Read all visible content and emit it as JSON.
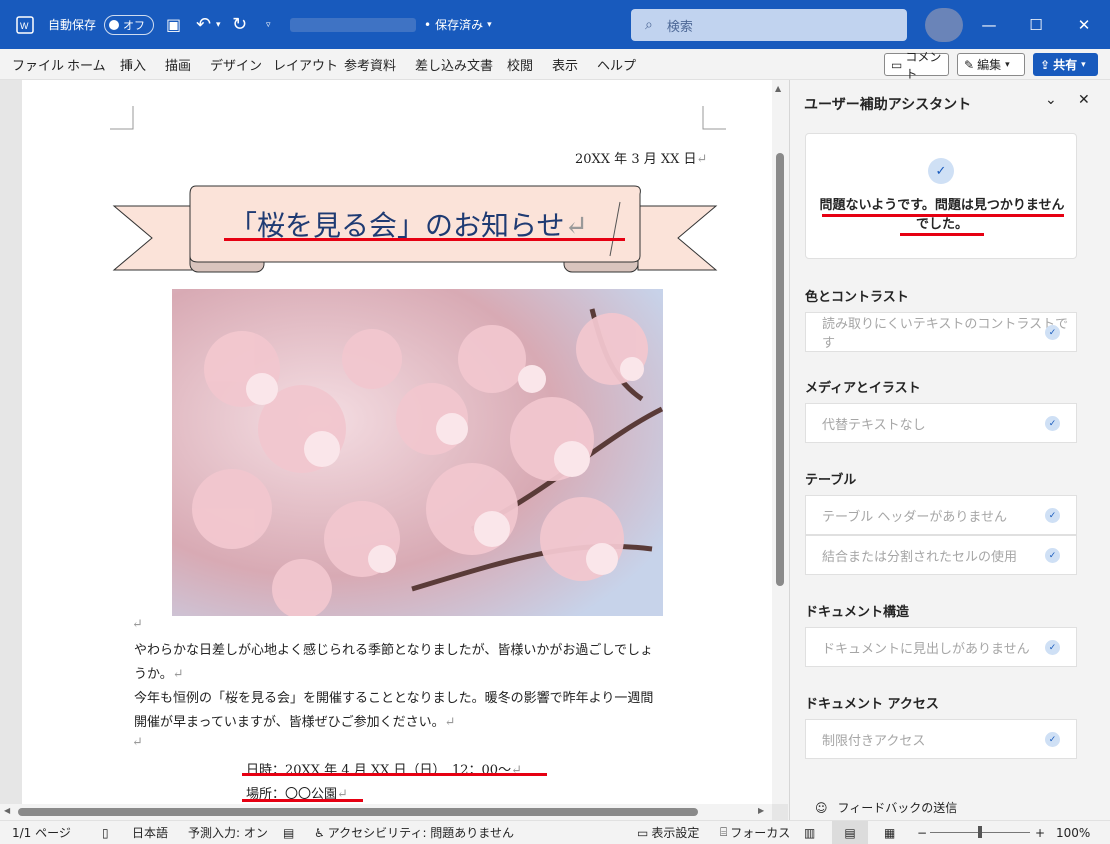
{
  "titlebar": {
    "autosave_label": "自動保存",
    "autosave_state": "オフ",
    "doc_status": "保存済み",
    "search_placeholder": "検索"
  },
  "ribbon": {
    "tabs": [
      "ファイル",
      "ホーム",
      "挿入",
      "描画",
      "デザイン",
      "レイアウト",
      "参考資料",
      "差し込み文書",
      "校閲",
      "表示",
      "ヘルプ"
    ],
    "comment_label": "コメント",
    "edit_label": "編集",
    "share_label": "共有"
  },
  "document": {
    "date": "20XX 年 3 月 XX 日",
    "title": "「桜を見る会」のお知らせ",
    "para1_line1": "やわらかな日差しが心地よく感じられる季節となりましたが、皆様いかがお過ごしでしょ",
    "para1_line2": "うか。",
    "para2_line1": "今年も恒例の「桜を見る会」を開催することとなりました。暖冬の影響で昨年より一週間",
    "para2_line2": "開催が早まっていますが、皆様ぜひご参加ください。",
    "datetime": "日時：20XX 年 4 月 XX 日（日）　12：00〜",
    "place": "場所：〇〇公園",
    "return_mark": "↵"
  },
  "pane": {
    "title": "ユーザー補助アシスタント",
    "ok_message": "問題ないようです。問題は見つかりませんでした。",
    "sections": [
      {
        "heading": "色とコントラスト",
        "items": [
          "読み取りにくいテキストのコントラストです"
        ]
      },
      {
        "heading": "メディアとイラスト",
        "items": [
          "代替テキストなし"
        ]
      },
      {
        "heading": "テーブル",
        "items": [
          "テーブル ヘッダーがありません",
          "結合または分割されたセルの使用"
        ]
      },
      {
        "heading": "ドキュメント構造",
        "items": [
          "ドキュメントに見出しがありません"
        ]
      },
      {
        "heading": "ドキュメント アクセス",
        "items": [
          "制限付きアクセス"
        ]
      }
    ],
    "feedback": "フィードバックの送信"
  },
  "statusbar": {
    "page": "1/1 ページ",
    "language": "日本語",
    "predictive": "予測入力: オン",
    "accessibility": "アクセシビリティ: 問題ありません",
    "display_settings": "表示設定",
    "focus": "フォーカス",
    "zoom": "100%"
  },
  "colors": {
    "accent": "#185abd",
    "annotation_red": "#e60012",
    "banner_fill": "#fbe3d9"
  }
}
